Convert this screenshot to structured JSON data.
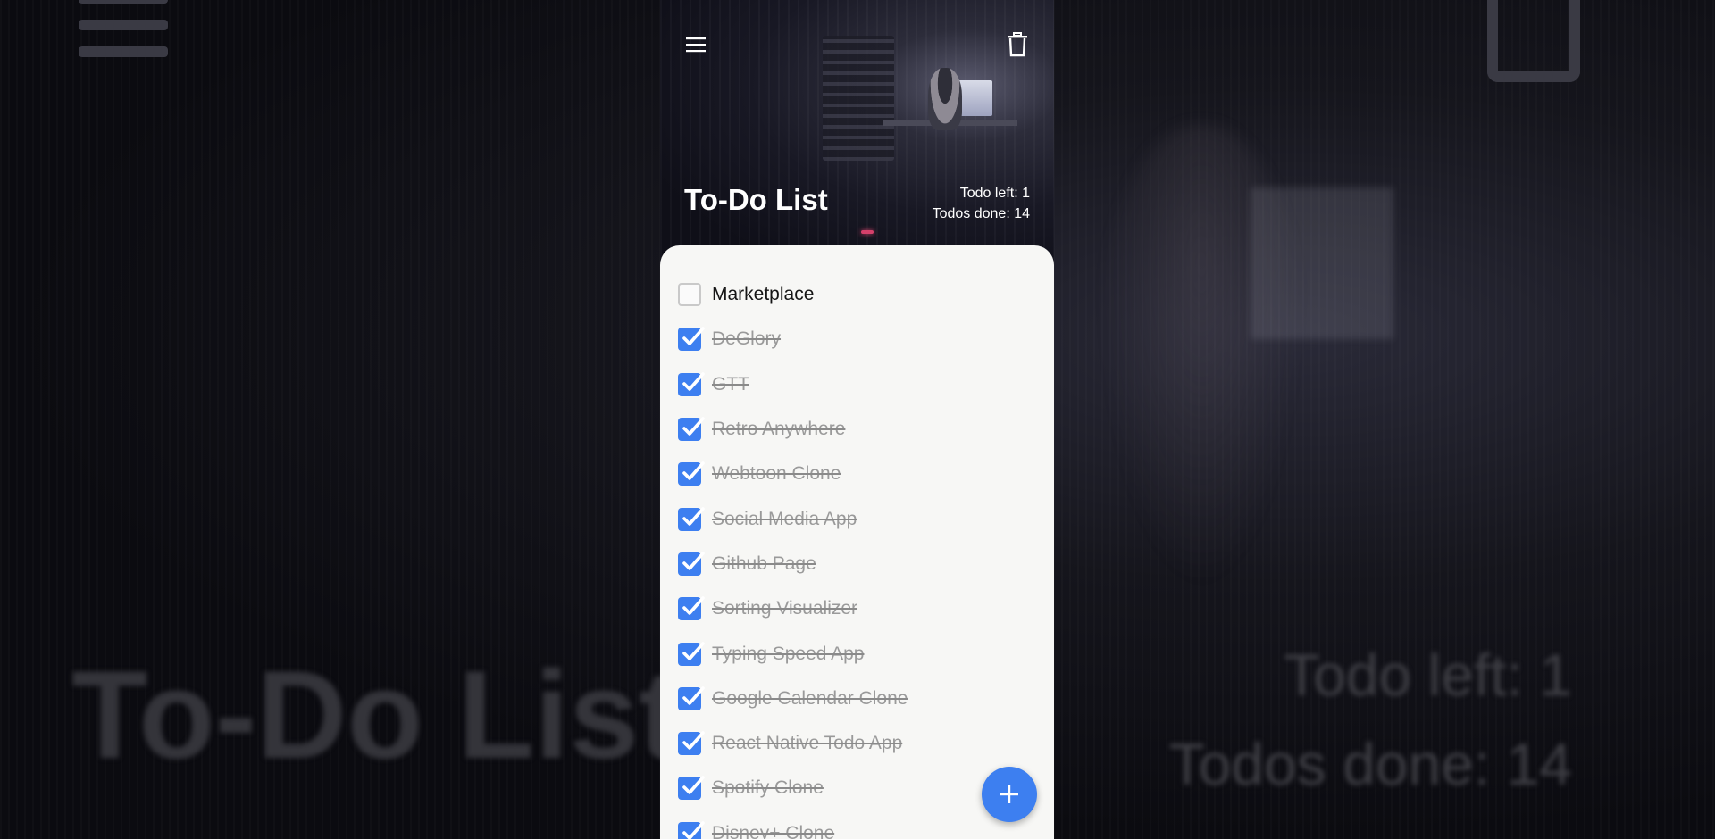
{
  "header": {
    "title": "To-Do List",
    "todo_left_label": "Todo left: 1",
    "todos_done_label": "Todos done: 14"
  },
  "icons": {
    "menu": "hamburger-menu-icon",
    "trash": "trash-icon",
    "add": "plus-icon",
    "check": "checkmark-icon"
  },
  "colors": {
    "accent": "#3d7ff0",
    "sheet": "#f7f7f5",
    "done_text": "#9a9a9a",
    "pending_text": "#151515"
  },
  "todos": [
    {
      "label": "Marketplace",
      "done": false
    },
    {
      "label": "DeGlory",
      "done": true
    },
    {
      "label": "GTT",
      "done": true
    },
    {
      "label": "Retro Anywhere",
      "done": true
    },
    {
      "label": "Webtoon Clone",
      "done": true
    },
    {
      "label": "Social Media App",
      "done": true
    },
    {
      "label": "Github Page",
      "done": true
    },
    {
      "label": "Sorting Visualizer",
      "done": true
    },
    {
      "label": "Typing Speed App",
      "done": true
    },
    {
      "label": "Google Calendar Clone",
      "done": true
    },
    {
      "label": "React Native Todo App",
      "done": true
    },
    {
      "label": "Spotify Clone",
      "done": true
    },
    {
      "label": "Disney+ Clone",
      "done": true
    }
  ]
}
